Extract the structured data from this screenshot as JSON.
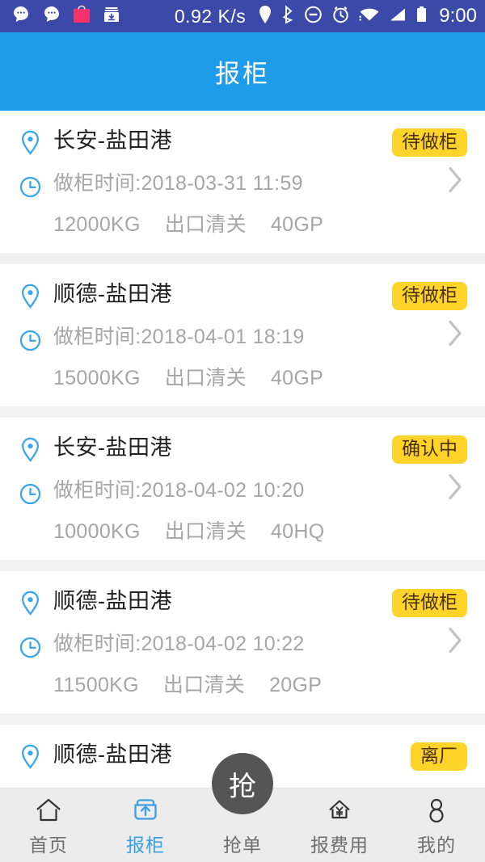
{
  "status_bar": {
    "network_speed": "0.92 K/s",
    "clock": "9:00",
    "left_icons": [
      "chat-bubble-icon",
      "chat-bubble-icon",
      "shopping-bag-icon",
      "download-tray-icon"
    ],
    "right_icons": [
      "location-pin-icon",
      "bluetooth-icon",
      "do-not-disturb-icon",
      "alarm-clock-icon",
      "wifi-icon",
      "cellular-signal-icon",
      "battery-icon"
    ],
    "bg_color": "#3b4aa8",
    "bag_color": "#f7326a"
  },
  "header": {
    "title": "报柜",
    "bg_color": "#1e9be9"
  },
  "colors": {
    "accent": "#1e9be9",
    "badge_bg": "#ffd42a",
    "badge_text": "#4a3000",
    "muted_text": "#a6a6a6",
    "primary_text": "#222222",
    "nav_active": "#3b9fe0",
    "fab_bg": "#555555"
  },
  "list": {
    "time_label_prefix": "做柜时间:",
    "items": [
      {
        "route": "长安-盐田港",
        "status": "待做柜",
        "time": "做柜时间:2018-03-31 11:59",
        "weight": "12000KG",
        "service": "出口清关",
        "container": "40GP"
      },
      {
        "route": "顺德-盐田港",
        "status": "待做柜",
        "time": "做柜时间:2018-04-01 18:19",
        "weight": "15000KG",
        "service": "出口清关",
        "container": "40GP"
      },
      {
        "route": "长安-盐田港",
        "status": "确认中",
        "time": "做柜时间:2018-04-02 10:20",
        "weight": "10000KG",
        "service": "出口清关",
        "container": "40HQ"
      },
      {
        "route": "顺德-盐田港",
        "status": "待做柜",
        "time": "做柜时间:2018-04-02 10:22",
        "weight": "11500KG",
        "service": "出口清关",
        "container": "20GP"
      },
      {
        "route": "顺德-盐田港",
        "status": "离厂",
        "time": "",
        "weight": "",
        "service": "",
        "container": ""
      }
    ]
  },
  "fab": {
    "label": "抢"
  },
  "bottom_nav": {
    "items": [
      {
        "label": "首页",
        "icon": "home-icon",
        "active": false
      },
      {
        "label": "报柜",
        "icon": "upload-box-icon",
        "active": true
      },
      {
        "label": "抢单",
        "icon": "grab-order-icon",
        "active": false
      },
      {
        "label": "报费用",
        "icon": "house-yuan-icon",
        "active": false
      },
      {
        "label": "我的",
        "icon": "person-icon",
        "active": false
      }
    ]
  }
}
